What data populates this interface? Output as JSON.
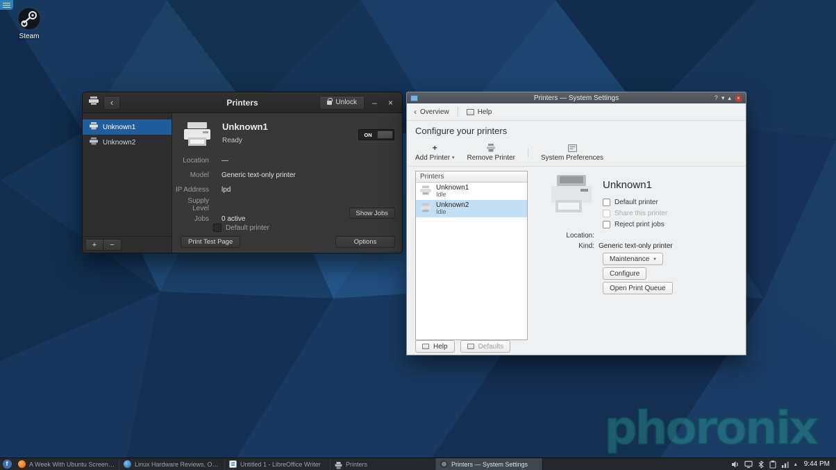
{
  "icons": {
    "back": "‹",
    "minimize": "–",
    "close": "×",
    "plus": "+",
    "minus": "−",
    "dropdown": "▾",
    "caret_up": "▴",
    "help_mark": "?",
    "shade_down": "▾",
    "shade_up": "▴",
    "fedora": "f"
  },
  "desktop": {
    "steam_label": "Steam"
  },
  "gnome": {
    "title": "Printers",
    "unlock_label": "Unlock",
    "sidebar_items": [
      {
        "name": "Unknown1"
      },
      {
        "name": "Unknown2"
      }
    ],
    "detail": {
      "name": "Unknown1",
      "status": "Ready",
      "switch_label": "ON",
      "rows": [
        {
          "label": "Location",
          "value": "—"
        },
        {
          "label": "Model",
          "value": "Generic text-only printer"
        },
        {
          "label": "IP Address",
          "value": "lpd"
        },
        {
          "label": "Supply Level",
          "value": ""
        },
        {
          "label": "Jobs",
          "value": "0 active"
        }
      ],
      "show_jobs_label": "Show Jobs",
      "default_printer_label": "Default printer",
      "print_test_label": "Print Test Page",
      "options_label": "Options"
    }
  },
  "kde": {
    "title": "Printers — System Settings",
    "nav": {
      "overview": "Overview",
      "help": "Help"
    },
    "heading": "Configure your printers",
    "actions": {
      "add": "Add Printer",
      "remove": "Remove Printer",
      "sysprefs": "System Preferences"
    },
    "list": {
      "header": "Printers",
      "items": [
        {
          "name": "Unknown1",
          "status": "Idle"
        },
        {
          "name": "Unknown2",
          "status": "Idle"
        }
      ]
    },
    "detail": {
      "name": "Unknown1",
      "checkboxes": [
        {
          "label": "Default printer"
        },
        {
          "label": "Share this printer"
        },
        {
          "label": "Reject print jobs"
        }
      ],
      "location_label": "Location:",
      "location_value": "",
      "kind_label": "Kind:",
      "kind_value": "Generic text-only printer",
      "maintenance_label": "Maintenance",
      "configure_label": "Configure",
      "open_queue_label": "Open Print Queue"
    },
    "footer": {
      "help": "Help",
      "defaults": "Defaults"
    }
  },
  "taskbar": {
    "tasks": [
      {
        "label": "A Week With Ubuntu Screensh..."
      },
      {
        "label": "Linux Hardware Reviews, Open..."
      },
      {
        "label": "Untitled 1 - LibreOffice Writer"
      },
      {
        "label": "Printers"
      },
      {
        "label": "Printers — System Settings"
      }
    ],
    "clock": "9:44 PM"
  },
  "watermark": "phoronix"
}
